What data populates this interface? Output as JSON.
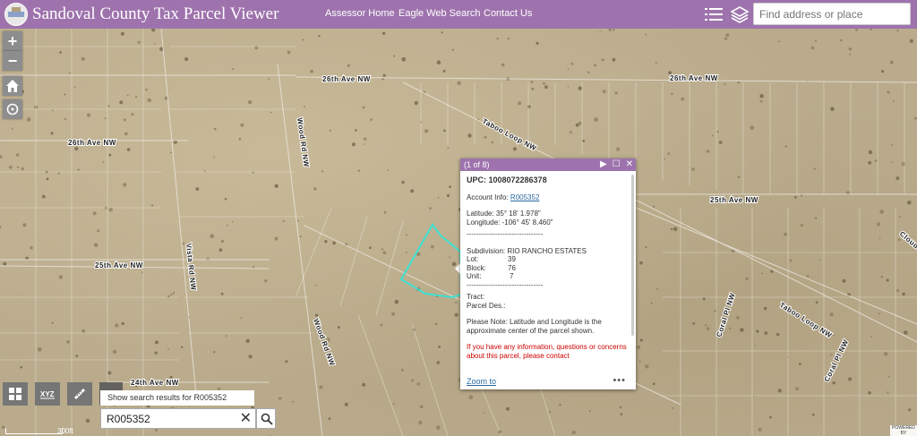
{
  "header": {
    "title": "Sandoval County Tax Parcel Viewer",
    "nav": [
      "Assessor Home",
      "Eagle Web Search",
      "Contact Us"
    ],
    "search_placeholder": "Find address or place",
    "list_icon": "list-icon",
    "layers_icon": "layers-icon",
    "logo_icon": "county-seal-icon",
    "accent_color": "#9e73ad"
  },
  "map": {
    "roads": [
      "26th Ave NW",
      "26th Ave NW",
      "26th Ave NW",
      "Taboo Loop NW",
      "25th Ave NW",
      "25th Ave NW",
      "Wood Rd NW",
      "Vista Rd NW",
      "Wood Rd NW",
      "Coral Pl NW",
      "Taboo Loop NW",
      "Coral Pl NW",
      "24th Ave NW",
      "Cloud"
    ],
    "highlight_color": "#3ee0d0"
  },
  "controls": {
    "zoom_in": "+",
    "zoom_out": "−",
    "home_icon": "home-icon",
    "locate_icon": "locate-icon",
    "basemap_icon": "basemap-gallery-icon",
    "coordinate_icon": "xy-coordinate-icon",
    "measure_icon": "measure-icon",
    "xy_label": "XYZ"
  },
  "search_widget": {
    "suggestion": "Show search results for R005352",
    "value": "R005352",
    "clear_icon": "close-icon",
    "search_icon": "search-icon"
  },
  "scale": {
    "label": "300ft"
  },
  "attribution": {
    "label": "POWERED BY"
  },
  "popup": {
    "pager": "(1 of 8)",
    "upc": "UPC: 1008072286378",
    "account_label": "Account Info: ",
    "account_link": "R005352",
    "latitude": "Latitude: 35° 18' 1.978\"",
    "longitude": "Longitude: -106° 45' 8.460\"",
    "sep": "--------------------------------",
    "subdivision": "Subdivision: RIO RANCHO ESTATES",
    "lot_label": "Lot:",
    "lot": "39",
    "block_label": "Block:",
    "block": "76",
    "unit_label": "Unit:",
    "unit": "7",
    "tract": "Tract:",
    "parcel_des": "Parcel Des.:",
    "note": "Please Note: Latitude and Longitude is the approximate center of the parcel shown.",
    "contact": "If you have any information, questions or concerns about this parcel, please contact",
    "zoom_to": "Zoom to",
    "more": "•••"
  }
}
